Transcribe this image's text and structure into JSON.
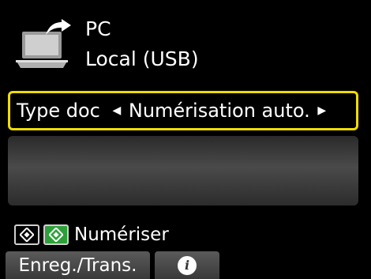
{
  "destination": {
    "title": "PC",
    "connection": "Local (USB)",
    "icon": "laptop-scan-icon"
  },
  "setting": {
    "label": "Type doc",
    "value": "Numérisation auto.",
    "prev_icon": "arrow-left-icon",
    "next_icon": "arrow-right-icon",
    "highlight_color": "#f0dc00"
  },
  "start": {
    "label": "Numériser",
    "mono_icon": "start-black-icon",
    "color_icon": "start-color-icon",
    "color_key_color": "#2ea03a"
  },
  "softkeys": {
    "left_label": "Enreg./Trans.",
    "middle_icon": "info-icon",
    "middle_glyph": "i"
  }
}
